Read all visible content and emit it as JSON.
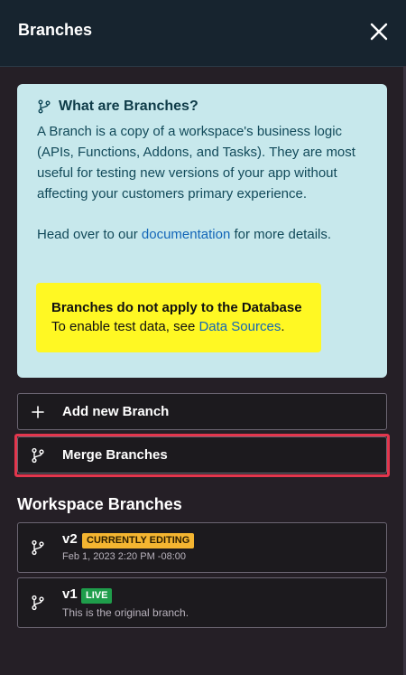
{
  "header": {
    "title": "Branches",
    "close_icon": "close-icon"
  },
  "info": {
    "title": "What are Branches?",
    "description": "A Branch is a copy of a workspace's business logic (APIs, Functions, Addons, and Tasks). They are most useful for testing new versions of your app without affecting your customers primary experience.",
    "docs_prefix": "Head over to our ",
    "docs_link": "documentation",
    "docs_suffix": " for more details.",
    "warning_title": "Branches do not apply to the Database",
    "warning_prefix": "To enable test data, see ",
    "warning_link": "Data Sources",
    "warning_suffix": "."
  },
  "actions": {
    "add_label": "Add new Branch",
    "merge_label": "Merge Branches"
  },
  "section": {
    "title": "Workspace Branches"
  },
  "branches": [
    {
      "name": "v2",
      "badge": "CURRENTLY EDITING",
      "subtitle": "Feb 1, 2023 2:20 PM -08:00"
    },
    {
      "name": "v1",
      "badge": "LIVE",
      "subtitle": "This is the original branch."
    }
  ],
  "colors": {
    "header_bg": "#17242f",
    "panel_bg": "#251f26",
    "info_bg": "#c7e8ec",
    "warning_bg": "#fff823",
    "highlight": "#e3364d",
    "badge_editing": "#f4b531",
    "badge_live": "#1f9d4b"
  }
}
